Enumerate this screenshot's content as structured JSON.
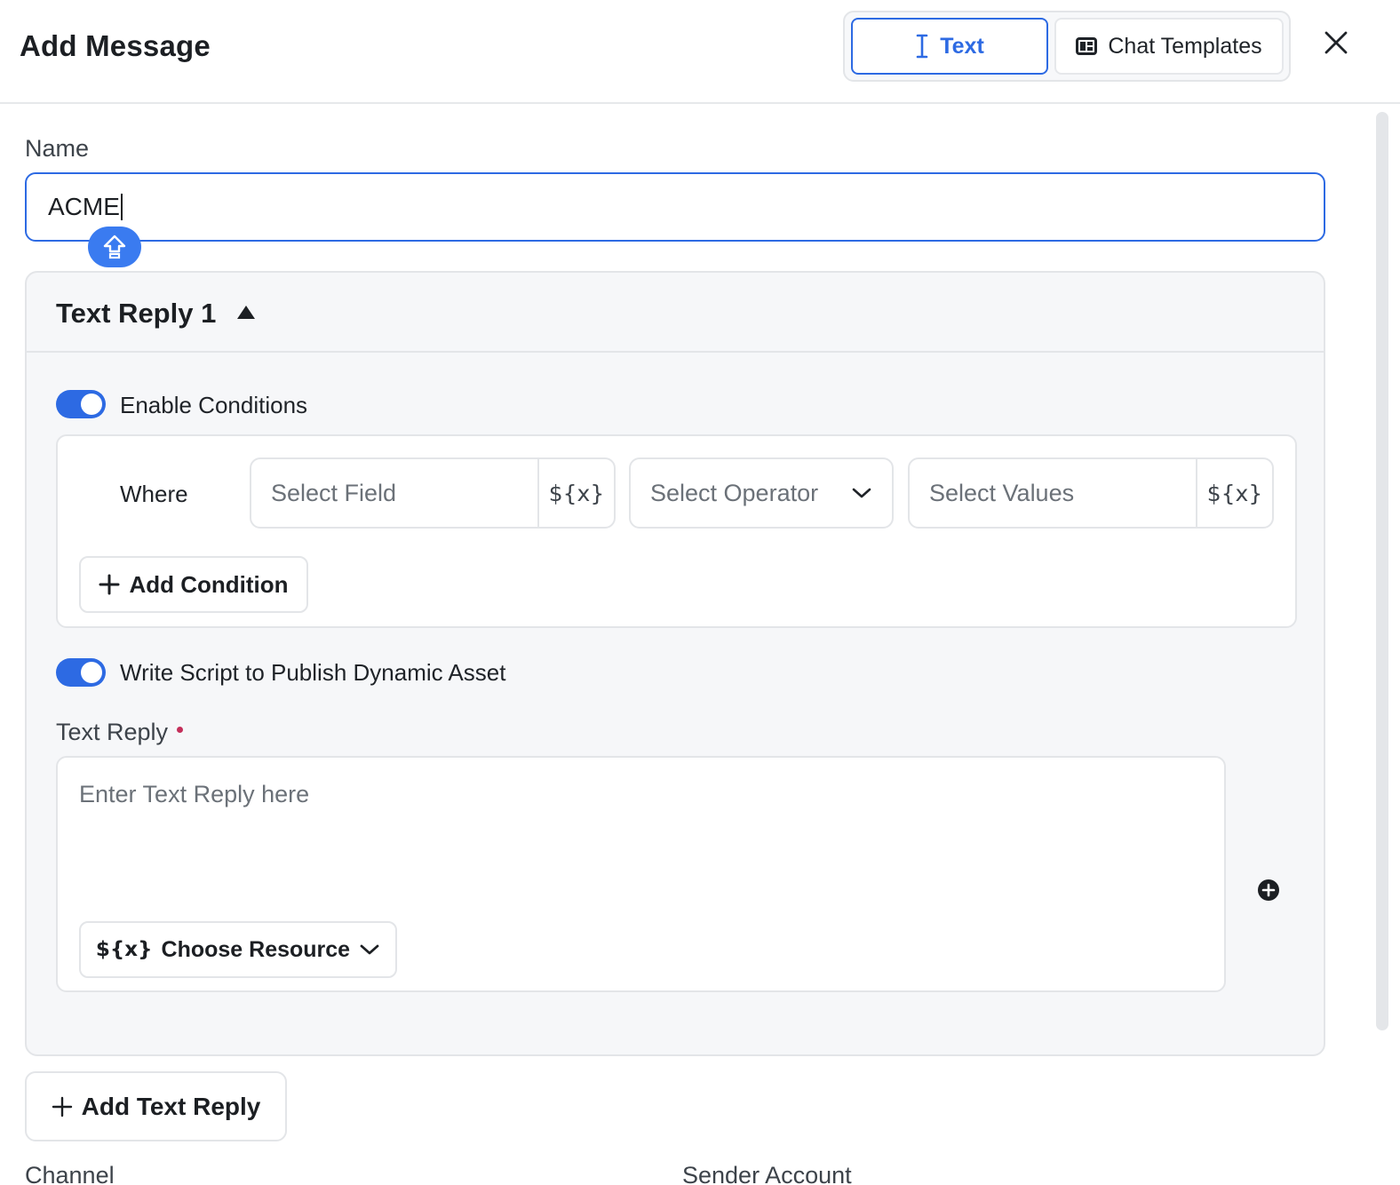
{
  "header": {
    "title": "Add Message",
    "tabs": [
      {
        "label": "Text",
        "icon": "text-cursor-icon",
        "active": true
      },
      {
        "label": "Chat Templates",
        "icon": "template-icon",
        "active": false
      }
    ]
  },
  "name": {
    "label": "Name",
    "value": "ACME"
  },
  "reply_panel": {
    "title": "Text Reply 1",
    "enable_conditions": {
      "label": "Enable Conditions",
      "on": true
    },
    "condition": {
      "where_label": "Where",
      "field_placeholder": "Select Field",
      "operator_placeholder": "Select Operator",
      "values_placeholder": "Select Values",
      "variable_token": "${x}"
    },
    "add_condition_label": "Add Condition",
    "write_script": {
      "label": "Write Script to Publish Dynamic Asset",
      "on": true
    },
    "text_reply_label": "Text Reply",
    "text_reply_placeholder": "Enter Text Reply here",
    "choose_resource_token": "${x}",
    "choose_resource_label": "Choose Resource"
  },
  "add_text_reply_label": "Add Text Reply",
  "bottom_labels": {
    "channel": "Channel",
    "sender_account": "Sender Account"
  },
  "colors": {
    "accent": "#2d6ae3",
    "required": "#c42f5a"
  }
}
